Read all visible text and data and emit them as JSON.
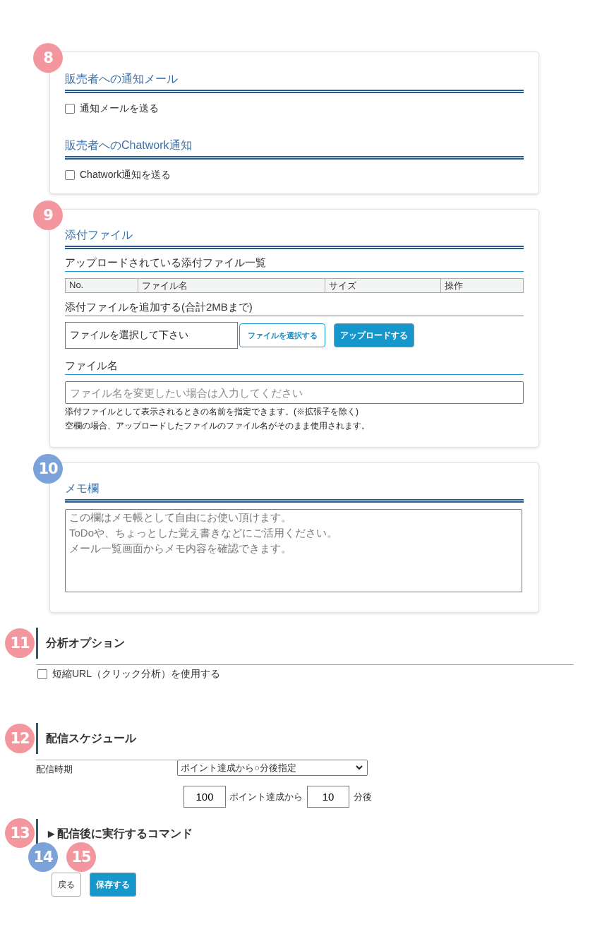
{
  "notification_panel": {
    "badge": {
      "number": "8",
      "color": "#f4969e"
    },
    "sections": [
      {
        "heading": "販売者への通知メール",
        "checkbox": {
          "label": "通知メールを送る",
          "checked": false
        }
      },
      {
        "heading": "販売者へのChatwork通知",
        "checkbox": {
          "label": "Chatwork通知を送る",
          "checked": false
        }
      }
    ]
  },
  "attachment_panel": {
    "badge": {
      "number": "9",
      "color": "#f4969e"
    },
    "heading": "添付ファイル",
    "uploaded_list": {
      "title": "アップロードされている添付ファイル一覧",
      "columns": [
        "No.",
        "ファイル名",
        "サイズ",
        "操作"
      ]
    },
    "add_file": {
      "title": "添付ファイルを追加する(合計2MBまで)",
      "file_field": {
        "value": "ファイルを選択して下さい"
      },
      "choose_button": "ファイルを選択する",
      "upload_button": "アップロードする"
    },
    "file_name": {
      "label": "ファイル名",
      "placeholder": "ファイル名を変更したい場合は入力してください",
      "notes": [
        "添付ファイルとして表示されるときの名前を指定できます。(※拡張子を除く)",
        "空欄の場合、アップロードしたファイルのファイル名がそのまま使用されます。"
      ]
    }
  },
  "memo_panel": {
    "badge": {
      "number": "10",
      "color": "#7ba3d9"
    },
    "heading": "メモ欄",
    "placeholder_lines": [
      "この欄はメモ帳として自由にお使い頂けます。",
      "ToDoや、ちょっとした覚え書きなどにご活用ください。",
      "メール一覧画面からメモ内容を確認できます。"
    ]
  },
  "analysis_options": {
    "badge": {
      "number": "11",
      "color": "#f4969e"
    },
    "heading": "分析オプション",
    "checkbox": {
      "label": "短縮URL（クリック分析）を使用する",
      "checked": false
    }
  },
  "schedule": {
    "badge": {
      "number": "12",
      "color": "#f4969e"
    },
    "heading": "配信スケジュール",
    "timing_label": "配信時期",
    "timing_select": {
      "value": "ポイント達成から○分後指定"
    },
    "points_field": {
      "value": "100"
    },
    "points_suffix": "ポイント達成から",
    "minutes_field": {
      "value": "10"
    },
    "minutes_suffix": "分後"
  },
  "post_commands": {
    "badge": {
      "number": "13",
      "color": "#f4969e"
    },
    "toggle_icon": "▶",
    "heading": "配信後に実行するコマンド"
  },
  "buttons": [
    {
      "label": "戻る",
      "kind": "secondary",
      "badge": {
        "number": "14",
        "color": "#7ba3d9"
      }
    },
    {
      "label": "保存する",
      "kind": "primary",
      "badge": {
        "number": "15",
        "color": "#f4969e"
      }
    }
  ]
}
